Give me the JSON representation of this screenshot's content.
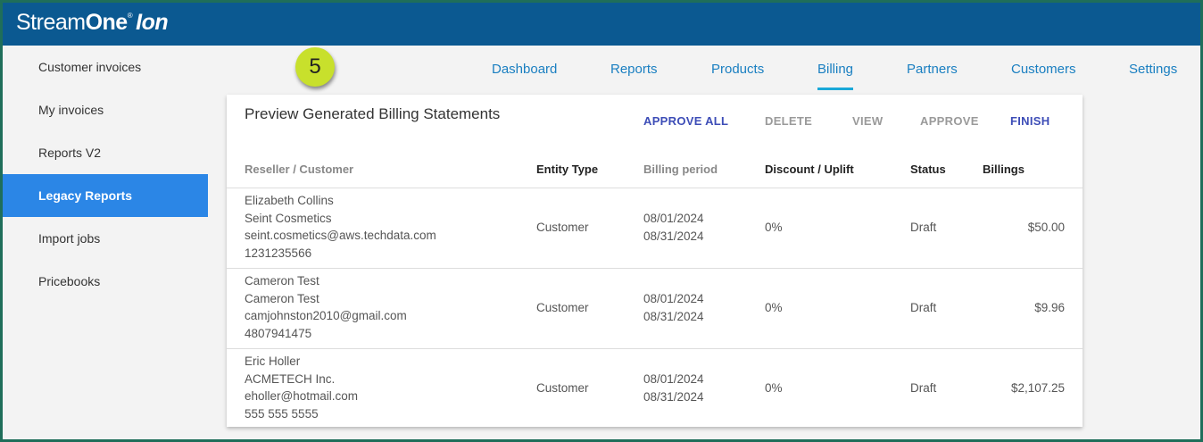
{
  "app": {
    "logo_part1": "Stream",
    "logo_part2": "One",
    "logo_reg": "®",
    "logo_part3": "Ion"
  },
  "sidebar": {
    "items": [
      {
        "label": "Customer invoices",
        "active": false
      },
      {
        "label": "My invoices",
        "active": false
      },
      {
        "label": "Reports V2",
        "active": false
      },
      {
        "label": "Legacy Reports",
        "active": true
      },
      {
        "label": "Import jobs",
        "active": false
      },
      {
        "label": "Pricebooks",
        "active": false
      }
    ]
  },
  "step_badge": "5",
  "nav": {
    "items": [
      {
        "label": "Dashboard"
      },
      {
        "label": "Reports"
      },
      {
        "label": "Products"
      },
      {
        "label": "Billing",
        "active": true
      },
      {
        "label": "Partners"
      },
      {
        "label": "Customers"
      },
      {
        "label": "Settings"
      }
    ]
  },
  "card": {
    "title": "Preview Generated Billing Statements",
    "actions": [
      {
        "label": "APPROVE ALL",
        "enabled": true
      },
      {
        "label": "DELETE",
        "enabled": false
      },
      {
        "label": "VIEW",
        "enabled": false
      },
      {
        "label": "APPROVE",
        "enabled": false
      },
      {
        "label": "FINISH",
        "enabled": true
      }
    ],
    "columns": [
      "Reseller / Customer",
      "Entity Type",
      "Billing period",
      "Discount / Uplift",
      "Status",
      "Billings"
    ],
    "rows": [
      {
        "name": "Elizabeth Collins",
        "company": "Seint Cosmetics",
        "email": "seint.cosmetics@aws.techdata.com",
        "phone": "1231235566",
        "entity_type": "Customer",
        "period_start": "08/01/2024",
        "period_end": "08/31/2024",
        "discount": "0%",
        "status": "Draft",
        "billings": "$50.00"
      },
      {
        "name": "Cameron Test",
        "company": "Cameron Test",
        "email": "camjohnston2010@gmail.com",
        "phone": "4807941475",
        "entity_type": "Customer",
        "period_start": "08/01/2024",
        "period_end": "08/31/2024",
        "discount": "0%",
        "status": "Draft",
        "billings": "$9.96"
      },
      {
        "name": "Eric Holler",
        "company": "ACMETECH Inc.",
        "email": "eholler@hotmail.com",
        "phone": "555 555 5555",
        "entity_type": "Customer",
        "period_start": "08/01/2024",
        "period_end": "08/31/2024",
        "discount": "0%",
        "status": "Draft",
        "billings": "$2,107.25"
      }
    ]
  },
  "colors": {
    "topbar": "#0b5991",
    "accent": "#2b86e6",
    "nav_link": "#1a7fc1",
    "action_enabled": "#3d4db7",
    "badge": "#c8e02c"
  }
}
